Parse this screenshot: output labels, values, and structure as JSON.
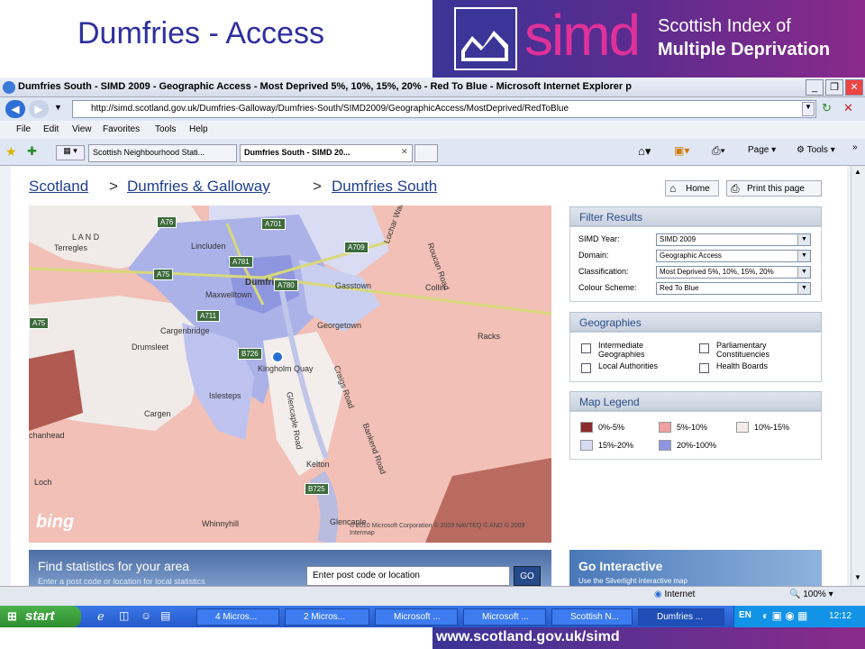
{
  "slide": {
    "title": "Dumfries - Access",
    "logo_word": "simd",
    "logo_line1": "Scottish Index of",
    "logo_line2": "Multiple Deprivation",
    "footer_url": "www.scotland.gov.uk/simd"
  },
  "browser": {
    "window_title": "Dumfries South - SIMD 2009 - Geographic Access - Most Deprived 5%, 10%, 15%, 20% - Red To Blue - Microsoft Internet Explorer p",
    "address": "http://simd.scotland.gov.uk/Dumfries-Galloway/Dumfries-South/SIMD2009/GeographicAccess/MostDeprived/RedToBlue",
    "menu": [
      "File",
      "Edit",
      "View",
      "Favorites",
      "Tools",
      "Help"
    ],
    "tabs": [
      "Scottish Neighbourhood Stati...",
      "Dumfries South - SIMD 20..."
    ],
    "toolbar_page": "Page",
    "toolbar_tools": "Tools",
    "status_zone": "Internet",
    "status_zoom": "100%"
  },
  "page": {
    "breadcrumb": [
      "Scotland",
      "Dumfries & Galloway",
      "Dumfries South"
    ],
    "home_label": "Home",
    "print_label": "Print this page",
    "filter": {
      "title": "Filter Results",
      "rows": [
        {
          "label": "SIMD Year:",
          "value": "SIMD 2009"
        },
        {
          "label": "Domain:",
          "value": "Geographic Access"
        },
        {
          "label": "Classification:",
          "value": "Most Deprived 5%, 10%, 15%, 20%"
        },
        {
          "label": "Colour Scheme:",
          "value": "Red To Blue"
        }
      ]
    },
    "geographies": {
      "title": "Geographies",
      "items": [
        "Intermediate Geographies",
        "Parliamentary Constituencies",
        "Local Authorities",
        "Health Boards"
      ]
    },
    "legend": {
      "title": "Map Legend",
      "items": [
        {
          "label": "0%-5%",
          "color": "#8b2b2b"
        },
        {
          "label": "5%-10%",
          "color": "#f0a0a0"
        },
        {
          "label": "10%-15%",
          "color": "#f2ecea"
        },
        {
          "label": "15%-20%",
          "color": "#d7dcf4"
        },
        {
          "label": "20%-100%",
          "color": "#8e96df"
        }
      ]
    },
    "find": {
      "title": "Find statistics for your area",
      "subtitle": "Enter a post code or location for local statistics",
      "input_value": "Enter post code or location",
      "go_label": "GO"
    },
    "interactive": {
      "title": "Go Interactive",
      "subtitle": "Use the Silverlight interactive map"
    },
    "map": {
      "places": [
        "Lincluden",
        "Terregles",
        "Dumfries",
        "Maxwelltown",
        "Gasstown",
        "Collin",
        "Cargenbridge",
        "Georgetown",
        "Drumsleet",
        "Racks",
        "Kingholm Quay",
        "Islesteps",
        "Cargen",
        "Kelton",
        "Whinnyhill",
        "Glencaple",
        "chanhead",
        "Loch"
      ],
      "roads": [
        "A76",
        "A701",
        "A709",
        "A75",
        "A780",
        "A781",
        "A711",
        "B726",
        "B725",
        "A75"
      ],
      "road_labels": [
        "Lochar Water",
        "Roucan Road",
        "Craigs Road",
        "Glencaple Road",
        "Bankend Road"
      ],
      "attribution": "© 2010 Microsoft Corporation   © 2009 NAVTEQ   © AND   © 2009 Intermap",
      "bing": "bing",
      "lands": "L  A  N  D"
    }
  },
  "taskbar": {
    "start": "start",
    "tasks": [
      "4 Micros...",
      "2 Micros...",
      "Microsoft ...",
      "Microsoft ...",
      "Scottish N...",
      "Dumfries ..."
    ],
    "lang": "EN",
    "clock": "12:12"
  }
}
